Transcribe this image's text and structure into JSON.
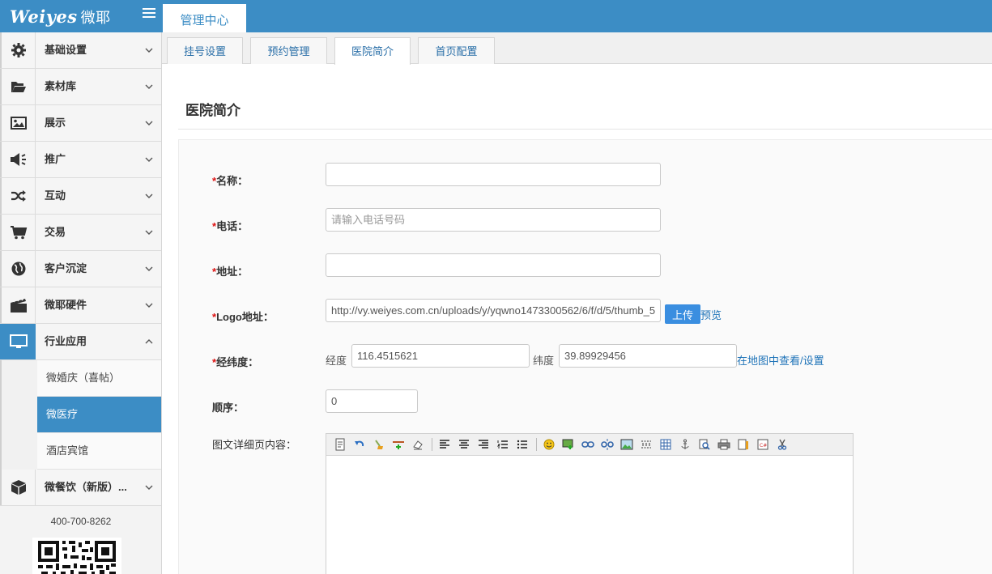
{
  "brand": {
    "logo_text": "Weiyes",
    "logo_cn": "微耶"
  },
  "top_tab": {
    "label": "管理中心"
  },
  "sidebar": {
    "items": [
      {
        "label": "基础设置",
        "icon": "gear-icon"
      },
      {
        "label": "素材库",
        "icon": "folder-open-icon"
      },
      {
        "label": "展示",
        "icon": "image-icon"
      },
      {
        "label": "推广",
        "icon": "megaphone-icon"
      },
      {
        "label": "互动",
        "icon": "shuffle-icon"
      },
      {
        "label": "交易",
        "icon": "cart-icon"
      },
      {
        "label": "客户沉淀",
        "icon": "globe-icon"
      },
      {
        "label": "微耶硬件",
        "icon": "clapperboard-icon"
      },
      {
        "label": "行业应用",
        "icon": "monitor-icon"
      }
    ],
    "sub_items": [
      {
        "label": "微婚庆（喜帖）"
      },
      {
        "label": "微医疗"
      },
      {
        "label": "酒店宾馆"
      }
    ],
    "extra_item": {
      "label": "微餐饮（新版）...",
      "icon": "cube-icon"
    },
    "phone": "400-700-8262"
  },
  "tabs": [
    {
      "label": "挂号设置"
    },
    {
      "label": "预约管理"
    },
    {
      "label": "医院简介"
    },
    {
      "label": "首页配置"
    }
  ],
  "page": {
    "title": "医院简介"
  },
  "form": {
    "name": {
      "label": "名称：",
      "value": ""
    },
    "phone": {
      "label": "电话：",
      "placeholder": "请输入电话号码"
    },
    "address": {
      "label": "地址：",
      "value": ""
    },
    "logo": {
      "label": "Logo地址：",
      "value": "http://vy.weiyes.com.cn/uploads/y/yqwno1473300562/6/f/d/5/thumb_5",
      "upload_label": "上传",
      "preview_label": "预览"
    },
    "coords": {
      "label": "经纬度：",
      "lng_label": "经度",
      "lng_value": "116.4515621",
      "lat_label": "纬度",
      "lat_value": "39.89929456",
      "map_link": "在地图中查看/设置"
    },
    "order": {
      "label": "顺序：",
      "value": "0"
    },
    "content": {
      "label": "图文详细页内容："
    }
  },
  "colors": {
    "accent": "#3c8dc5",
    "required": "#dd1111",
    "link": "#1e73b8"
  }
}
